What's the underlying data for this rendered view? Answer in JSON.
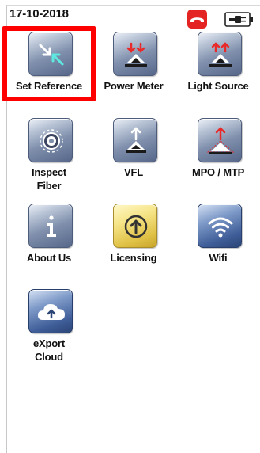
{
  "status": {
    "date": "17-10-2018"
  },
  "icons": {
    "phone": "phone-hangup-icon",
    "battery": "battery-plug-icon"
  },
  "colors": {
    "selection": "#ff0000",
    "phone_button": "#e42423"
  },
  "apps": [
    {
      "id": "set-reference",
      "label": "Set Reference",
      "icon": "set-reference-icon",
      "selected": true
    },
    {
      "id": "power-meter",
      "label": "Power Meter",
      "icon": "power-meter-icon"
    },
    {
      "id": "light-source",
      "label": "Light Source",
      "icon": "light-source-icon"
    },
    {
      "id": "inspect-fiber",
      "label": "Inspect\nFiber",
      "icon": "inspect-fiber-icon"
    },
    {
      "id": "vfl",
      "label": "VFL",
      "icon": "vfl-icon"
    },
    {
      "id": "mpo-mtp",
      "label": "MPO / MTP",
      "icon": "mpo-mtp-icon"
    },
    {
      "id": "about-us",
      "label": "About Us",
      "icon": "info-icon"
    },
    {
      "id": "licensing",
      "label": "Licensing",
      "icon": "licensing-icon"
    },
    {
      "id": "wifi",
      "label": "Wifi",
      "icon": "wifi-icon"
    },
    {
      "id": "export-cloud",
      "label": "eXport\nCloud",
      "icon": "cloud-upload-icon"
    }
  ]
}
